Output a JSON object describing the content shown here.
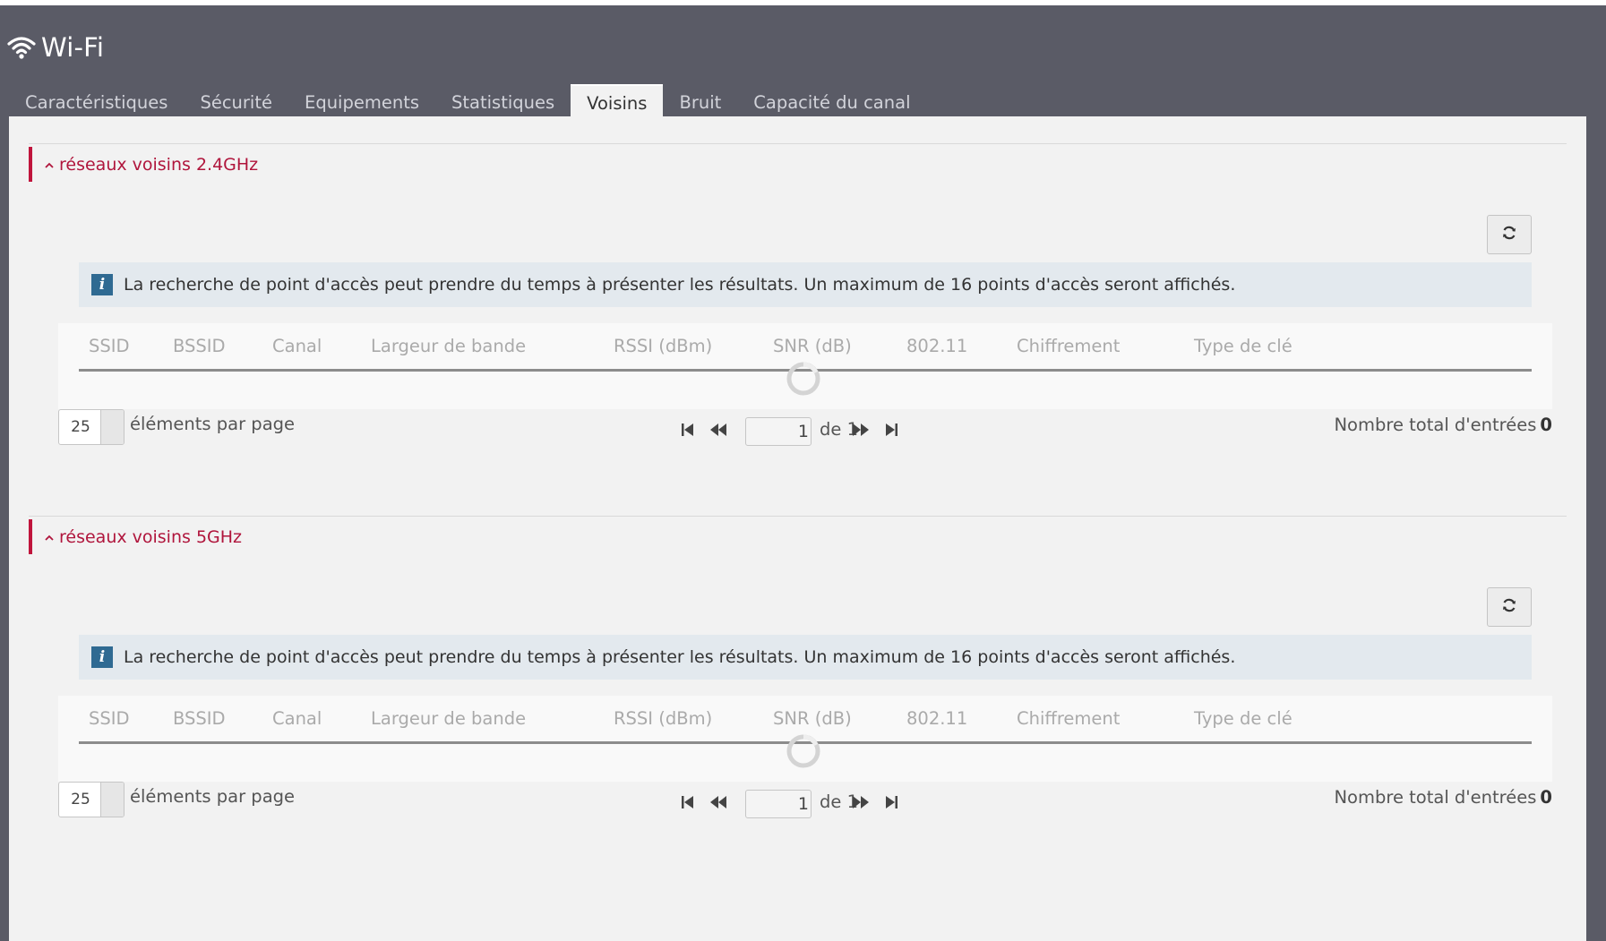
{
  "app": {
    "title": "Wi-Fi",
    "icon": "wifi-icon"
  },
  "tabs": [
    {
      "label": "Caractéristiques",
      "active": false
    },
    {
      "label": "Sécurité",
      "active": false
    },
    {
      "label": "Equipements",
      "active": false
    },
    {
      "label": "Statistiques",
      "active": false
    },
    {
      "label": "Voisins",
      "active": true
    },
    {
      "label": "Bruit",
      "active": false
    },
    {
      "label": "Capacité du canal",
      "active": false
    }
  ],
  "colors": {
    "header_bg": "#5a5b66",
    "accent": "#b0153c",
    "content_bg": "#f2f2f2",
    "info_bg": "#e3e9ee",
    "info_icon": "#2f6a92"
  },
  "sections": [
    {
      "title": "réseaux voisins 2.4GHz",
      "info": "La recherche de point d'accès peut prendre du temps à présenter les résultats. Un maximum de 16 points d'accès seront affichés.",
      "columns": [
        "SSID",
        "BSSID",
        "Canal",
        "Largeur de bande",
        "RSSI (dBm)",
        "SNR (dB)",
        "802.11",
        "Chiffrement",
        "Type de clé"
      ],
      "per_page_value": "25",
      "per_page_label": "éléments par page",
      "page_current": "1",
      "page_of": "de 1",
      "total_label": "Nombre total d'entrées",
      "total_value": "0"
    },
    {
      "title": "réseaux voisins 5GHz",
      "info": "La recherche de point d'accès peut prendre du temps à présenter les résultats. Un maximum de 16 points d'accès seront affichés.",
      "columns": [
        "SSID",
        "BSSID",
        "Canal",
        "Largeur de bande",
        "RSSI (dBm)",
        "SNR (dB)",
        "802.11",
        "Chiffrement",
        "Type de clé"
      ],
      "per_page_value": "25",
      "per_page_label": "éléments par page",
      "page_current": "1",
      "page_of": "de 1",
      "total_label": "Nombre total d'entrées",
      "total_value": "0"
    }
  ]
}
